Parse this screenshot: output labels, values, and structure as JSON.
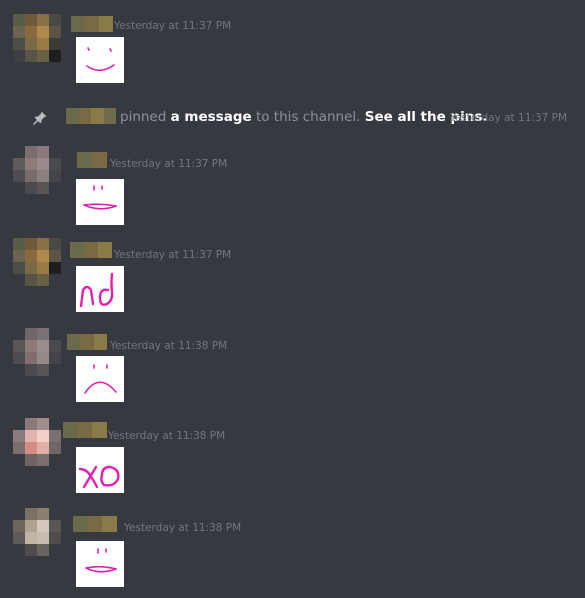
{
  "messages": [
    {
      "timestamp": "Yesterday at 11:37 PM",
      "drawing": "smiley-face-icon"
    },
    {
      "timestamp": "Yesterday at 11:37 PM",
      "drawing": "flat-mouth-face-icon"
    },
    {
      "timestamp": "Yesterday at 11:37 PM",
      "drawing": "nd-scribble-icon"
    },
    {
      "timestamp": "Yesterday at 11:38 PM",
      "drawing": "frowny-face-icon"
    },
    {
      "timestamp": "Yesterday at 11:38 PM",
      "drawing": "xd-scribble-icon"
    },
    {
      "timestamp": "Yesterday at 11:38 PM",
      "drawing": "flat-mouth-face-icon"
    }
  ],
  "pin_notice": {
    "prefix": "pinned ",
    "link_message": "a message",
    "middle": " to this channel. ",
    "link_pins": "See all the pins.",
    "timestamp": "Yesterday at 11:37 PM"
  },
  "colors": {
    "background": "#36393f",
    "timestamp": "#72767d",
    "ink": "#e020b0"
  }
}
